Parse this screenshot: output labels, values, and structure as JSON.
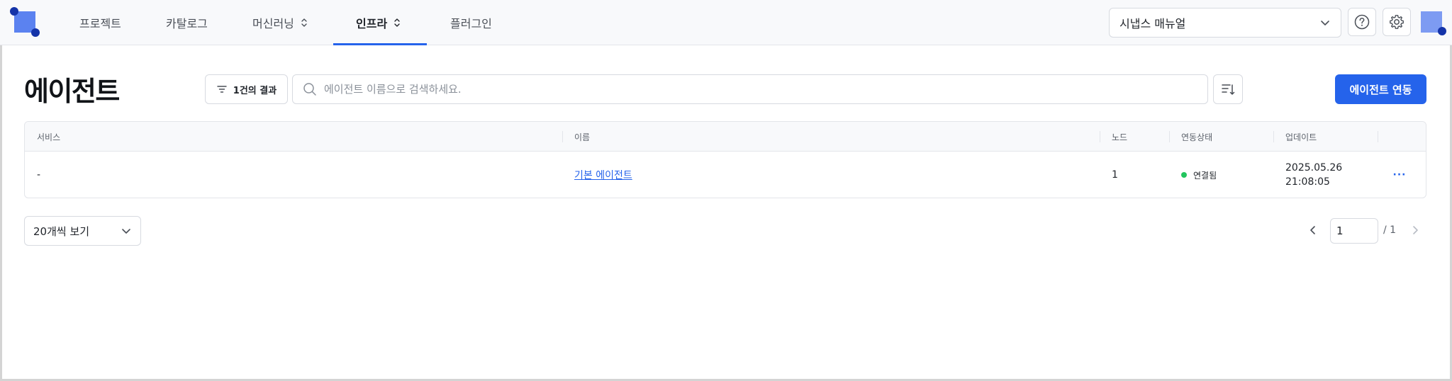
{
  "nav": {
    "tabs": [
      {
        "label": "프로젝트",
        "dropdown": false
      },
      {
        "label": "카탈로그",
        "dropdown": false
      },
      {
        "label": "머신러닝",
        "dropdown": true
      },
      {
        "label": "인프라",
        "dropdown": true,
        "active": true
      },
      {
        "label": "플러그인",
        "dropdown": false
      }
    ],
    "project_select": "시냅스 매뉴얼",
    "accent_color": "#2563eb"
  },
  "page": {
    "title": "에이전트",
    "filter_label": "1건의 결과",
    "search_placeholder": "에이전트 이름으로 검색하세요.",
    "primary_button": "에이전트 연동"
  },
  "table": {
    "headers": [
      "서비스",
      "이름",
      "노드",
      "연동상태",
      "업데이트"
    ],
    "rows": [
      {
        "service": "-",
        "name": "기본 에이전트",
        "nodes": "1",
        "status": "연결됨",
        "status_color": "#22c55e",
        "updated_date": "2025.05.26",
        "updated_time": "21:08:05",
        "more": "···"
      }
    ]
  },
  "pagination": {
    "page_size": "20개씩 보기",
    "current_page": "1",
    "total": "/ 1"
  }
}
